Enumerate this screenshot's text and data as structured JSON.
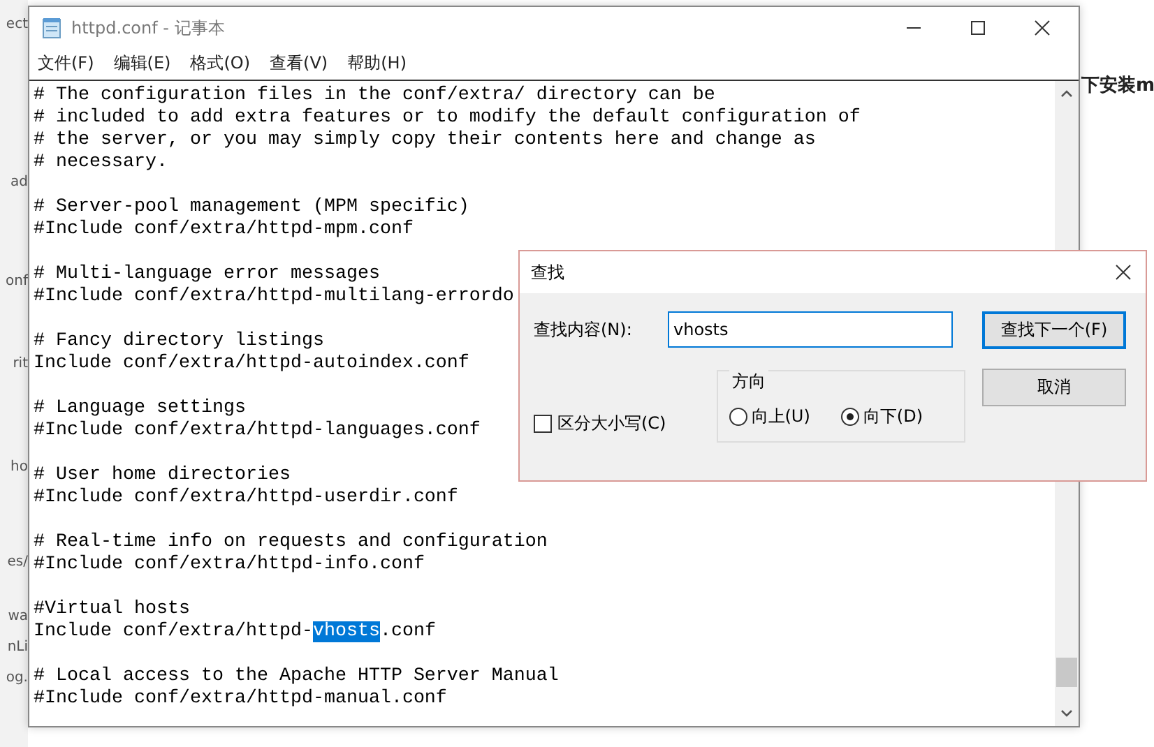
{
  "background_page": {
    "left_fragments": [
      "ect",
      "ad",
      "onf",
      "rit",
      "ho",
      "es/",
      "wa",
      "nLi",
      "og."
    ],
    "right_fragment": "下安装m"
  },
  "window": {
    "title": "httpd.conf - 记事本"
  },
  "menu": [
    "文件(F)",
    "编辑(E)",
    "格式(O)",
    "查看(V)",
    "帮助(H)"
  ],
  "editor": {
    "blocks": [
      {
        "lines": [
          {
            "text": "# The configuration files in the conf/extra/ directory can be"
          },
          {
            "text": "# included to add extra features or to modify the default configuration of"
          },
          {
            "text": "# the server, or you may simply copy their contents here and change as"
          },
          {
            "text": "# necessary."
          }
        ]
      },
      {
        "lines": [
          {
            "text": "# Server-pool management (MPM specific)"
          },
          {
            "text": "#Include conf/extra/httpd-mpm.conf"
          }
        ]
      },
      {
        "lines": [
          {
            "text": "# Multi-language error messages"
          },
          {
            "text": "#Include conf/extra/httpd-multilang-errordo"
          }
        ]
      },
      {
        "lines": [
          {
            "text": "# Fancy directory listings"
          },
          {
            "text": "Include conf/extra/httpd-autoindex.conf"
          }
        ]
      },
      {
        "lines": [
          {
            "text": "# Language settings"
          },
          {
            "text": "#Include conf/extra/httpd-languages.conf"
          }
        ]
      },
      {
        "lines": [
          {
            "text": "# User home directories"
          },
          {
            "text": "#Include conf/extra/httpd-userdir.conf"
          }
        ]
      },
      {
        "lines": [
          {
            "text": "# Real-time info on requests and configuration"
          },
          {
            "text": "#Include conf/extra/httpd-info.conf"
          }
        ]
      },
      {
        "lines": [
          {
            "text": "#Virtual hosts"
          },
          {
            "text": "Include conf/extra/httpd-",
            "selection": "vhosts",
            "after": ".conf"
          }
        ]
      },
      {
        "lines": [
          {
            "text": "# Local access to the Apache HTTP Server Manual"
          },
          {
            "text": "#Include conf/extra/httpd-manual.conf"
          }
        ]
      }
    ]
  },
  "find_dialog": {
    "title": "查找",
    "find_label": "查找内容(N):",
    "find_value": "vhosts",
    "find_next_button": "查找下一个(F)",
    "cancel_button": "取消",
    "match_case": {
      "label": "区分大小写(C)",
      "checked": false
    },
    "direction": {
      "label": "方向",
      "options": [
        {
          "label": "向上(U)",
          "selected": false
        },
        {
          "label": "向下(D)",
          "selected": true
        }
      ]
    }
  }
}
